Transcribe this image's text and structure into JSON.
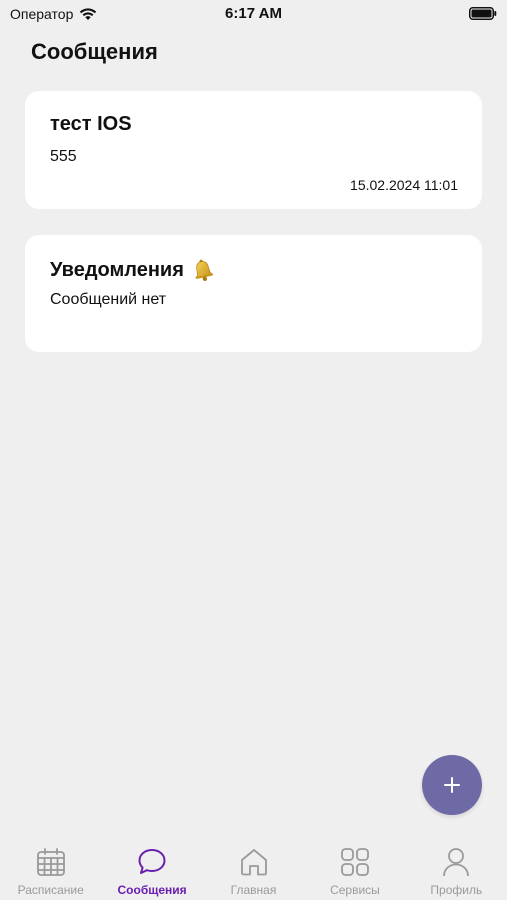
{
  "status_bar": {
    "carrier": "Оператор",
    "time": "6:17 AM"
  },
  "page": {
    "title": "Сообщения"
  },
  "messages": [
    {
      "title": "тест IOS",
      "text": "555",
      "date": "15.02.2024 11:01"
    }
  ],
  "notifications": {
    "title": "Уведомления",
    "icon": "bell-icon",
    "text": "Сообщений нет"
  },
  "fab": {
    "icon": "plus-icon",
    "color": "#6e6aa6"
  },
  "tab_bar": {
    "active_color": "#6a1fb0",
    "inactive_color": "#9a9a9a",
    "tabs": [
      {
        "label": "Расписание",
        "icon": "calendar-icon",
        "active": false
      },
      {
        "label": "Сообщения",
        "icon": "chat-bubble-icon",
        "active": true
      },
      {
        "label": "Главная",
        "icon": "home-icon",
        "active": false
      },
      {
        "label": "Сервисы",
        "icon": "grid-icon",
        "active": false
      },
      {
        "label": "Профиль",
        "icon": "person-icon",
        "active": false
      }
    ]
  }
}
